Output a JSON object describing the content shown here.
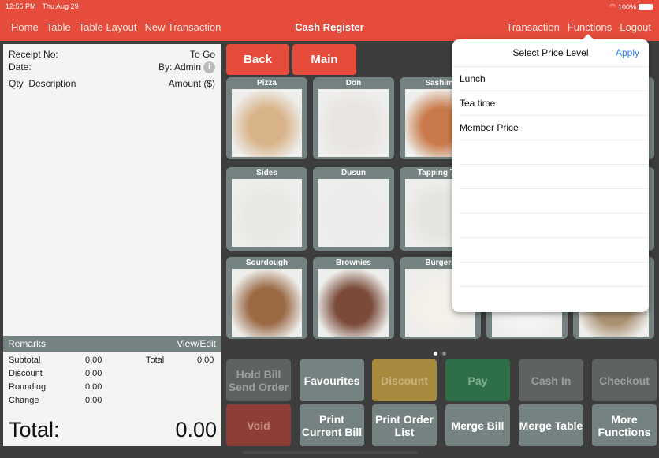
{
  "status": {
    "time": "12:55 PM",
    "date": "Thu Aug 29",
    "battery": "100%"
  },
  "nav_left": [
    "Home",
    "Table",
    "Table Layout",
    "New Transaction"
  ],
  "title": "Cash Register",
  "nav_right": [
    "Transaction",
    "Functions",
    "Logout"
  ],
  "receipt": {
    "receipt_no_label": "Receipt No:",
    "order_type": "To Go",
    "date_label": "Date:",
    "by": "By: Admin",
    "qty": "Qty",
    "description": "Description",
    "amount": "Amount ($)",
    "remarks": "Remarks",
    "view_edit": "View/Edit",
    "subtotal_label": "Subtotal",
    "subtotal": "0.00",
    "discount_label": "Discount",
    "discount": "0.00",
    "rounding_label": "Rounding",
    "rounding": "0.00",
    "change_label": "Change",
    "change": "0.00",
    "total_small_label": "Total",
    "total_small": "0.00",
    "total_label": "Total:",
    "total": "0.00"
  },
  "back": "Back",
  "main": "Main",
  "tiles": [
    {
      "label": "Pizza",
      "color": "#d9b48a"
    },
    {
      "label": "Don",
      "color": "#e8e4df"
    },
    {
      "label": "Sashimi",
      "color": "#c97a4a"
    },
    {
      "label": "",
      "color": "#ccc"
    },
    {
      "label": "",
      "color": "#ccc"
    },
    {
      "label": "Sides",
      "color": "#e9e7e4"
    },
    {
      "label": "Dusun",
      "color": "#ecebea"
    },
    {
      "label": "Tapping Tea",
      "color": "#e6e4e0"
    },
    {
      "label": "",
      "color": "#ccc"
    },
    {
      "label": "",
      "color": "#b89870"
    },
    {
      "label": "Sourdough",
      "color": "#9a6a45"
    },
    {
      "label": "Brownies",
      "color": "#7a4a3a"
    },
    {
      "label": "Burgers",
      "color": "#f4f0ea"
    },
    {
      "label": "",
      "color": "#f4f4f4"
    },
    {
      "label": "",
      "color": "#a89070"
    }
  ],
  "functions": [
    {
      "label": "Hold Bill Send Order",
      "bg": "#5e6362",
      "fg": "#9aa09f"
    },
    {
      "label": "Favourites",
      "bg": "#748381",
      "fg": "#fff"
    },
    {
      "label": "Discount",
      "bg": "#a88a3f",
      "fg": "#c9b27a"
    },
    {
      "label": "Pay",
      "bg": "#2e6e49",
      "fg": "#7fb08f"
    },
    {
      "label": "Cash In",
      "bg": "#5e6362",
      "fg": "#9aa09f"
    },
    {
      "label": "Checkout",
      "bg": "#5e6362",
      "fg": "#9aa09f"
    },
    {
      "label": "Void",
      "bg": "#8f3e35",
      "fg": "#c58a82"
    },
    {
      "label": "Print Current Bill",
      "bg": "#748381",
      "fg": "#fff"
    },
    {
      "label": "Print Order List",
      "bg": "#748381",
      "fg": "#fff"
    },
    {
      "label": "Merge Bill",
      "bg": "#748381",
      "fg": "#fff"
    },
    {
      "label": "Merge Table",
      "bg": "#748381",
      "fg": "#fff"
    },
    {
      "label": "More Functions",
      "bg": "#748381",
      "fg": "#fff"
    }
  ],
  "price_popup": {
    "title": "Select Price Level",
    "apply": "Apply",
    "items": [
      "Lunch",
      "Tea time",
      "Member Price",
      "",
      "",
      "",
      "",
      "",
      "",
      ""
    ]
  }
}
